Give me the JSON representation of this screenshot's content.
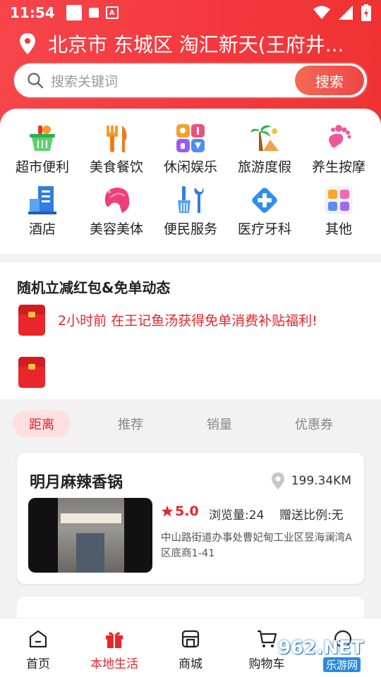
{
  "status_bar": {
    "time": "11:54"
  },
  "header": {
    "location": "北京市 东城区 淘汇新天(王府井...",
    "search_placeholder": "搜索关键词",
    "search_button": "搜索"
  },
  "categories": [
    {
      "label": "超市便利",
      "icon": "basket-icon"
    },
    {
      "label": "美食餐饮",
      "icon": "utensils-icon"
    },
    {
      "label": "休闲娱乐",
      "icon": "entertainment-icon"
    },
    {
      "label": "旅游度假",
      "icon": "palm-tree-icon"
    },
    {
      "label": "养生按摩",
      "icon": "footprint-icon"
    },
    {
      "label": "酒店",
      "icon": "hotel-icon"
    },
    {
      "label": "美容美体",
      "icon": "beauty-icon"
    },
    {
      "label": "便民服务",
      "icon": "tools-icon"
    },
    {
      "label": "医疗牙科",
      "icon": "medical-cross-icon"
    },
    {
      "label": "其他",
      "icon": "grid-icon"
    }
  ],
  "dynamics": {
    "title": "随机立减红包&免单动态",
    "message": "2小时前 在王记鱼汤获得免单消费补贴福利!"
  },
  "tabs": [
    {
      "label": "距离",
      "active": true
    },
    {
      "label": "推荐",
      "active": false
    },
    {
      "label": "销量",
      "active": false
    },
    {
      "label": "优惠券",
      "active": false
    }
  ],
  "shop": {
    "name": "明月麻辣香锅",
    "distance": "199.34KM",
    "rating": "5.0",
    "views": "浏览量:24",
    "ratio": "赠送比例:无",
    "address": "中山路街道办事处曹妃甸工业区昱海澜湾A区底商1-41"
  },
  "nav": [
    {
      "label": "首页",
      "icon": "home-icon",
      "active": false
    },
    {
      "label": "本地生活",
      "icon": "gift-icon",
      "active": true
    },
    {
      "label": "商城",
      "icon": "store-icon",
      "active": false
    },
    {
      "label": "购物车",
      "icon": "cart-icon",
      "active": false
    },
    {
      "label": "我的",
      "icon": "profile-icon",
      "active": false
    }
  ],
  "watermark": {
    "line1": "962.NET",
    "line2": "乐游网"
  },
  "colors": {
    "brand_red": "#e8262b",
    "header_red": "#f3383d"
  }
}
